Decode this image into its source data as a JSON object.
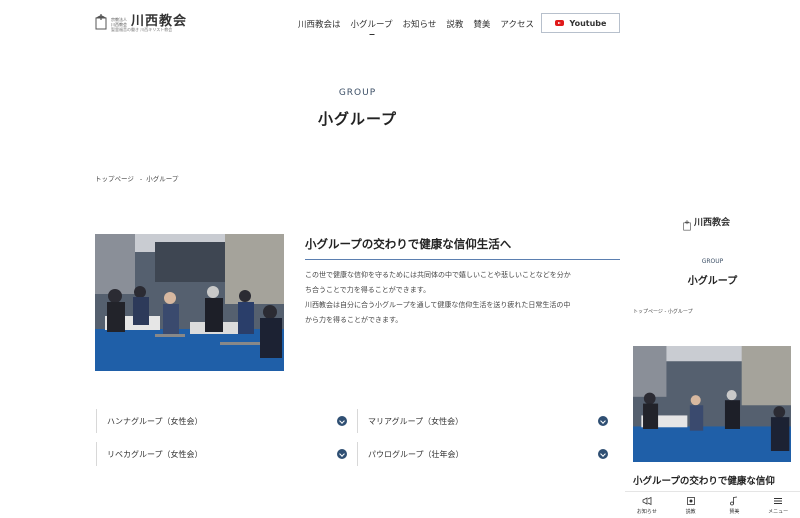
{
  "header": {
    "logo_small_top": "宗教法人",
    "logo_small_bottom": "川西教会",
    "logo_main": "川西教会",
    "logo_sub": "聖霊福音の働き 川西キリスト教会",
    "nav": [
      "川西教会は",
      "小グループ",
      "お知らせ",
      "説教",
      "賛美",
      "アクセス"
    ],
    "active_nav_index": 1,
    "youtube_label": "Youtube"
  },
  "hero": {
    "en_title": "GROUP",
    "title": "小グループ"
  },
  "breadcrumb": {
    "home": "トップページ",
    "separator": "-",
    "current": "小グループ"
  },
  "section": {
    "heading": "小グループの交わりで健康な信仰生活へ",
    "paragraphs": [
      "この世で健康な信仰を守るためには共同体の中で嬉しいことや悲しいことなどを分か",
      "ち合うことで力を得ることができます。",
      "川西教会は自分に合う小グループを通して健康な信仰生活を送り疲れた日常生活の中",
      "から力を得ることができます。"
    ]
  },
  "groups": [
    {
      "label": "ハンナグループ（女性会）"
    },
    {
      "label": "マリアグループ（女性会）"
    },
    {
      "label": "リベカグループ（女性会）"
    },
    {
      "label": "パウログループ（壮年会）"
    }
  ],
  "mobile": {
    "logo_main": "川西教会",
    "en_title": "GROUP",
    "title": "小グループ",
    "breadcrumb": "トップページ - 小グループ",
    "heading": "小グループの交わりで健康な信仰",
    "tabs": [
      "お知らせ",
      "説教",
      "賛美",
      "メニュー"
    ]
  },
  "colors": {
    "accent": "#2f4f73",
    "heading_rule": "#5b7fb0",
    "youtube_red": "#e0191a"
  }
}
